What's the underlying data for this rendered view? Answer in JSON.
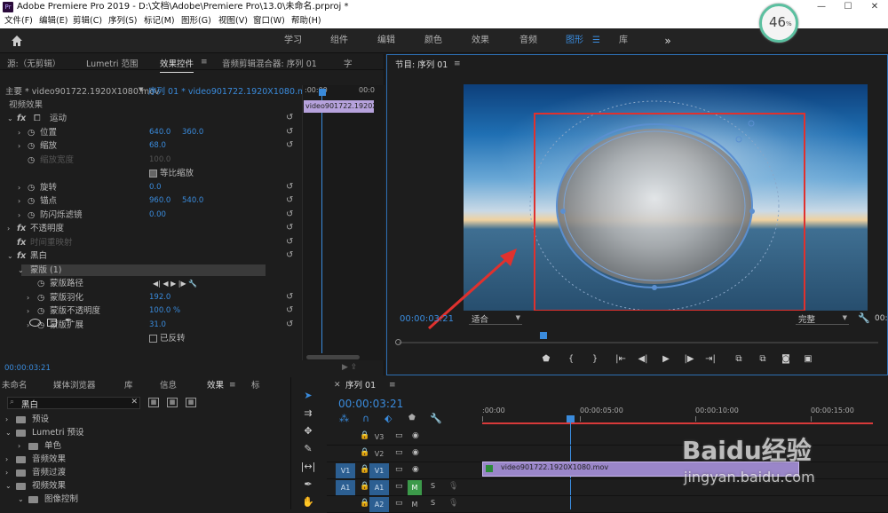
{
  "titlebar": {
    "app_icon": "Pr",
    "title": "Adobe Premiere Pro 2019 - D:\\文档\\Adobe\\Premiere Pro\\13.0\\未命名.prproj *",
    "minimize": "—",
    "maximize": "☐",
    "close": "✕"
  },
  "menubar": {
    "items": [
      "文件(F)",
      "编辑(E)",
      "剪辑(C)",
      "序列(S)",
      "标记(M)",
      "图形(G)",
      "视图(V)",
      "窗口(W)",
      "帮助(H)"
    ]
  },
  "overlay_badge": {
    "value": "46",
    "unit": "%"
  },
  "workspace": {
    "tabs": [
      "学习",
      "组件",
      "编辑",
      "颜色",
      "效果",
      "音频",
      "图形",
      "库"
    ],
    "active": "图形",
    "more": "»"
  },
  "effect_controls": {
    "tabs": [
      "源:（无剪辑）",
      "Lumetri 范围",
      "效果控件",
      "音频剪辑混合器: 序列 01",
      "字"
    ],
    "active_tab": "效果控件",
    "source_label": "主要 * video901722.1920X1080.mov",
    "sequence_label": "序列 01 * video901722.1920X1080.mov",
    "ruler_start": ":00:00",
    "ruler_end": "00:0",
    "clip_label": "video901722.1920X1",
    "section_title": "视频效果",
    "rows": [
      {
        "label": "运动",
        "fx": "fx"
      },
      {
        "label": "位置",
        "v1": "640.0",
        "v2": "360.0"
      },
      {
        "label": "缩放",
        "v1": "68.0"
      },
      {
        "label": "缩放宽度",
        "v1": "100.0"
      },
      {
        "label": "等比缩放"
      },
      {
        "label": "旋转",
        "v1": "0.0"
      },
      {
        "label": "锚点",
        "v1": "960.0",
        "v2": "540.0"
      },
      {
        "label": "防闪烁滤镜",
        "v1": "0.00"
      },
      {
        "label": "不透明度",
        "fx": "fx"
      },
      {
        "label": "时间重映射",
        "fx": "fx"
      },
      {
        "label": "黑白",
        "fx": "fx"
      },
      {
        "label": "蒙版 (1)"
      },
      {
        "label": "蒙版路径"
      },
      {
        "label": "蒙版羽化",
        "v1": "192.0"
      },
      {
        "label": "蒙版不透明度",
        "v1": "100.0 %"
      },
      {
        "label": "蒙版扩展",
        "v1": "31.0"
      },
      {
        "label": "已反转"
      }
    ],
    "timecode": "00:00:03:21"
  },
  "program_monitor": {
    "title": "节目: 序列 01",
    "timecode": "00:00:03:21",
    "fit": "适合",
    "quality": "完整",
    "end_timecode": "00:"
  },
  "project_panel": {
    "tabs": [
      "未命名",
      "媒体浏览器",
      "库",
      "信息",
      "效果",
      "标"
    ],
    "active_tab": "效果",
    "search_value": "黑白",
    "items": [
      {
        "label": "预设",
        "indent": 0
      },
      {
        "label": "Lumetri 预设",
        "indent": 0
      },
      {
        "label": "单色",
        "indent": 1
      },
      {
        "label": "音频效果",
        "indent": 0
      },
      {
        "label": "音频过渡",
        "indent": 0
      },
      {
        "label": "视频效果",
        "indent": 0
      },
      {
        "label": "图像控制",
        "indent": 1
      }
    ]
  },
  "timeline": {
    "title": "序列 01",
    "timecode": "00:00:03:21",
    "ruler": [
      ":00:00",
      "00:00:05:00",
      "00:00:10:00",
      "00:00:15:00"
    ],
    "tracks": [
      "V3",
      "V2",
      "V1",
      "A1",
      "A2"
    ],
    "source_v": "V1",
    "source_a": "A1",
    "clip_label": "video901722.1920X1080.mov",
    "m_label": "M",
    "s_label": "S"
  },
  "watermark": {
    "brand": "Baidu经验",
    "url": "jingyan.baidu.com"
  },
  "colors": {
    "accent": "#3a8bdc",
    "mask_box": "#e0312e",
    "clip": "#9a86c9",
    "arrow": "#e0312e"
  }
}
